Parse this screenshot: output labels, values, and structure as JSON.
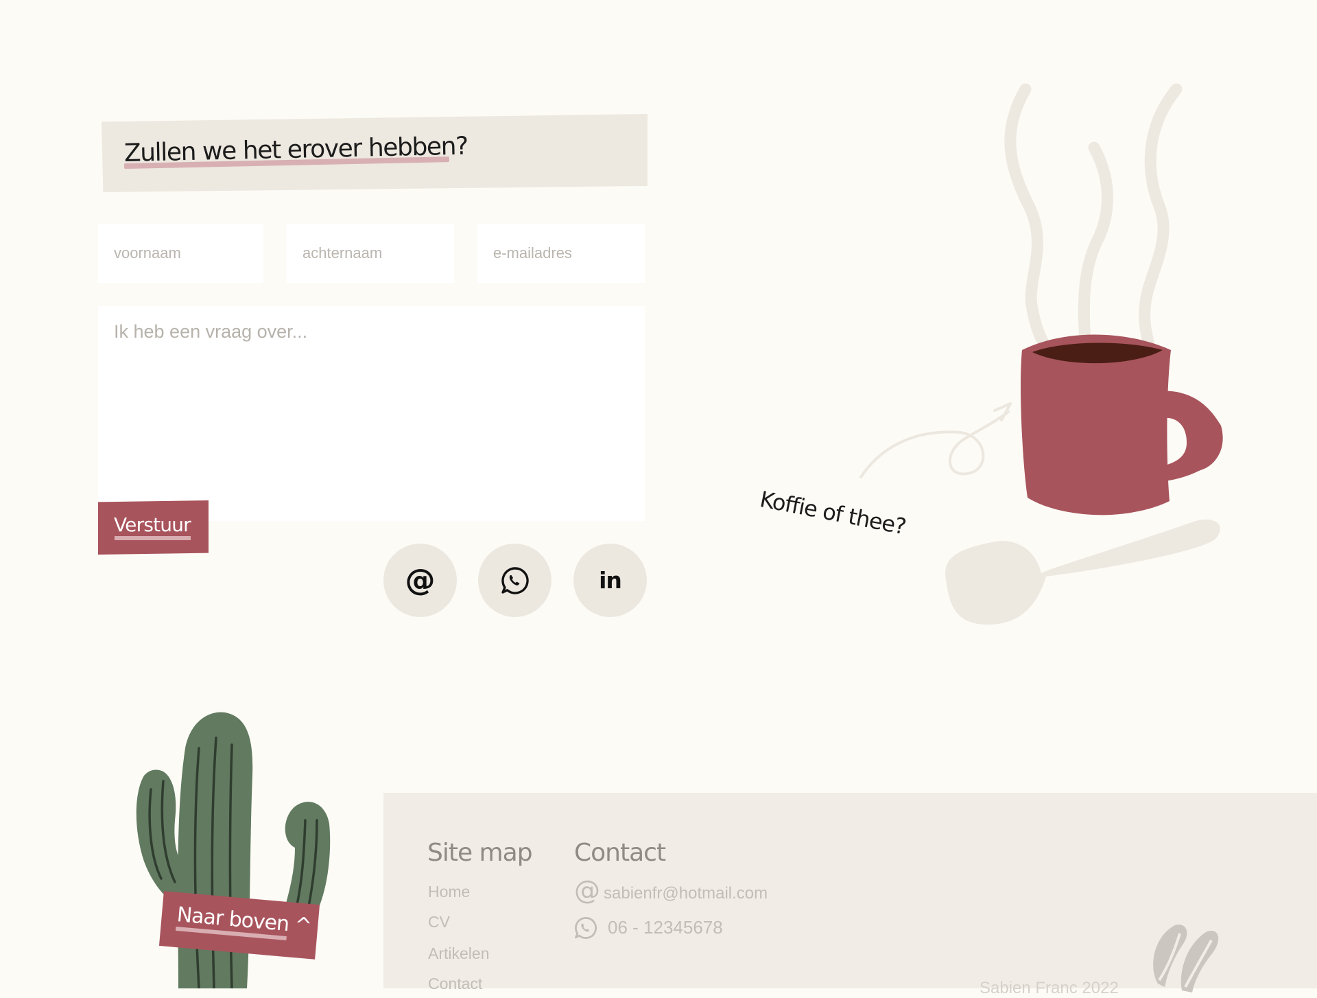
{
  "contact_form": {
    "heading": "Zullen we het erover hebben?",
    "first_name_placeholder": "voornaam",
    "last_name_placeholder": "achternaam",
    "email_placeholder": "e-mailadres",
    "message_placeholder": "Ik heb een vraag over...",
    "submit_label": "Verstuur"
  },
  "social": [
    {
      "name": "email",
      "icon": "at-sign-icon",
      "glyph": "@"
    },
    {
      "name": "whatsapp",
      "icon": "whatsapp-icon"
    },
    {
      "name": "linkedin",
      "icon": "linkedin-icon",
      "glyph": "in"
    }
  ],
  "illustration": {
    "caption": "Koffie of thee?"
  },
  "footer": {
    "sitemap_heading": "Site map",
    "sitemap_links": [
      "Home",
      "CV",
      "Artikelen",
      "Contact"
    ],
    "contact_heading": "Contact",
    "email_icon": "@",
    "email": "sabienfr@hotmail.com",
    "phone": "06 - 12345678",
    "copyright": "Sabien Franc 2022",
    "back_to_top_label": "Naar boven ^"
  },
  "colors": {
    "background": "#fdfbf6",
    "accent": "#a8545c",
    "panel": "#ede8e0",
    "cactus": "#617a60"
  }
}
